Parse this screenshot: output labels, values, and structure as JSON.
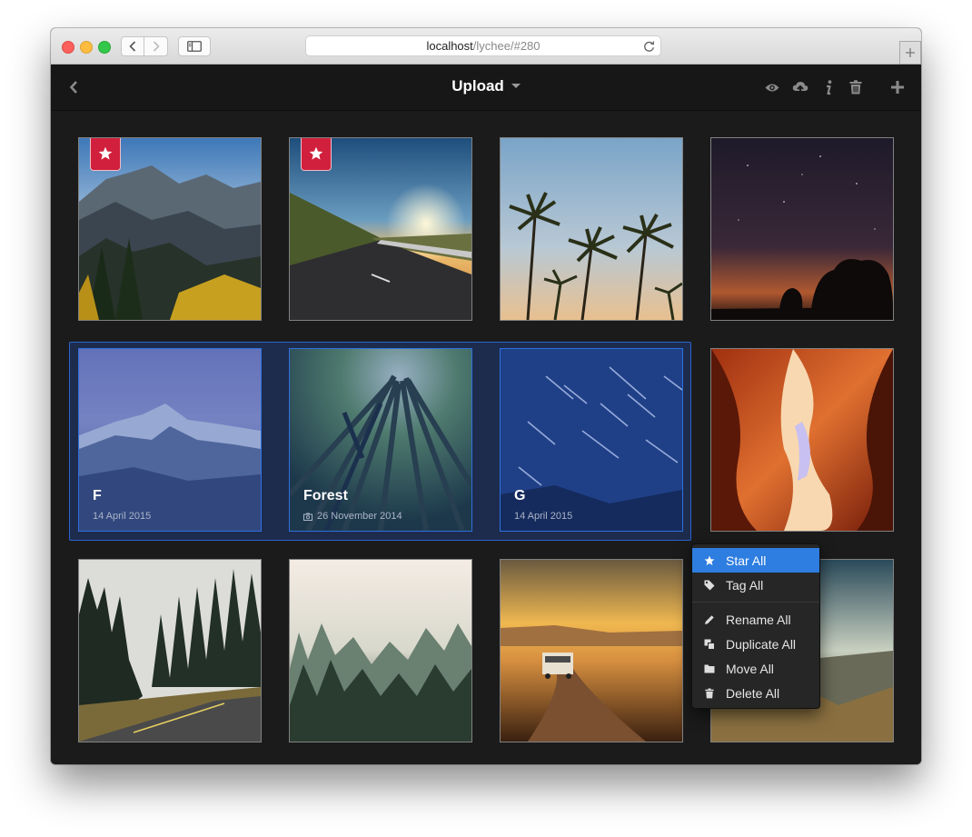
{
  "browser": {
    "url_host": "localhost",
    "url_path": "/lychee/#280"
  },
  "header": {
    "title": "Upload",
    "icons": [
      "back-icon",
      "eye-icon",
      "cloud-upload-icon",
      "info-icon",
      "trash-icon",
      "plus-icon"
    ]
  },
  "photos": [
    {
      "id": "mountains",
      "starred": true,
      "selected": false
    },
    {
      "id": "road-sunset",
      "starred": true,
      "selected": false
    },
    {
      "id": "palms",
      "starred": false,
      "selected": false
    },
    {
      "id": "night-sky",
      "starred": false,
      "selected": false
    },
    {
      "id": "album-f",
      "selected": true,
      "title": "F",
      "date": "14 April 2015"
    },
    {
      "id": "album-forest",
      "selected": true,
      "title": "Forest",
      "date": "26 November 2014"
    },
    {
      "id": "album-g",
      "selected": true,
      "title": "G",
      "date": "14 April 2015"
    },
    {
      "id": "canyon",
      "starred": false,
      "selected": false
    },
    {
      "id": "foggy-road",
      "starred": false,
      "selected": false
    },
    {
      "id": "misty-forest",
      "starred": false,
      "selected": false
    },
    {
      "id": "desert-car",
      "starred": false,
      "selected": false
    },
    {
      "id": "valley",
      "starred": false,
      "selected": false
    }
  ],
  "context_menu": {
    "items": [
      {
        "label": "Star All",
        "icon": "star-icon",
        "active": true
      },
      {
        "label": "Tag All",
        "icon": "tag-icon"
      },
      {
        "label": "Rename All",
        "icon": "pencil-icon"
      },
      {
        "label": "Duplicate All",
        "icon": "duplicate-icon"
      },
      {
        "label": "Move All",
        "icon": "folder-icon"
      },
      {
        "label": "Delete All",
        "icon": "trash-icon"
      }
    ]
  },
  "colors": {
    "accent": "#2e7de0",
    "star_badge": "#d0203d",
    "background": "#1b1b1b"
  }
}
